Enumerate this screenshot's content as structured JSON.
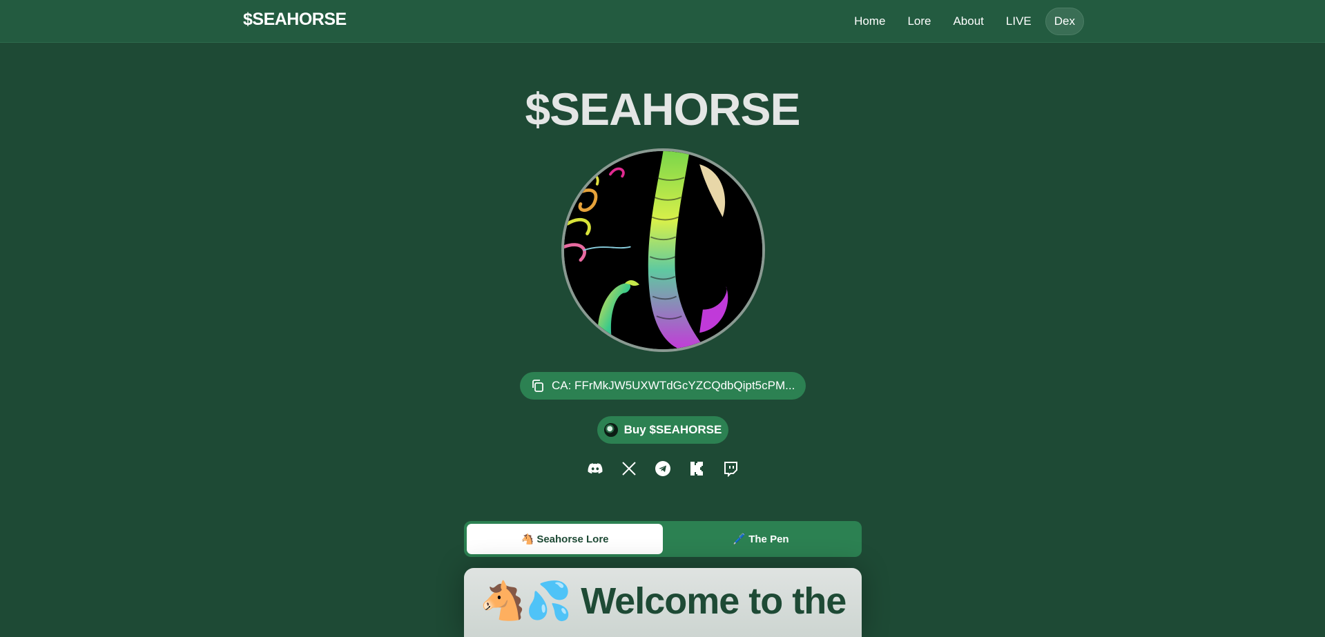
{
  "nav": {
    "brand": "$SEAHORSE",
    "links": [
      "Home",
      "Lore",
      "About",
      "LIVE",
      "Dex"
    ]
  },
  "hero": {
    "title": "$SEAHORSE",
    "avatar_icon": "seahorse-artwork-image"
  },
  "contract": {
    "label": "CA: FFrMkJW5UXWTdGcYZCQdbQipt5cPM...",
    "icon": "copy-icon"
  },
  "buy": {
    "label": "Buy $SEAHORSE",
    "icon": "coin-icon"
  },
  "socials": [
    "discord-icon",
    "x-icon",
    "telegram-icon",
    "kick-icon",
    "twitch-icon"
  ],
  "tabs": [
    {
      "label": "🐴 Seahorse Lore",
      "active": true
    },
    {
      "label": "🖊️ The Pen",
      "active": false
    }
  ],
  "card": {
    "heading": "🐴💦 Welcome to the"
  },
  "colors": {
    "background": "#1e4a35",
    "navbar": "#235b40",
    "accent": "#2c8152",
    "title": "#e4e6e5"
  }
}
